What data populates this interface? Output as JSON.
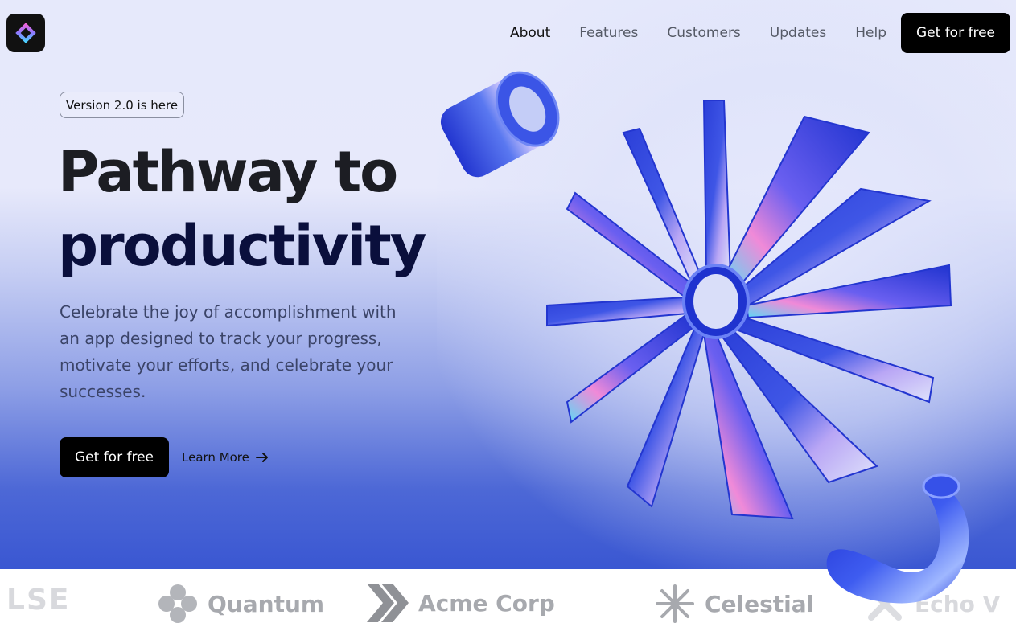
{
  "nav": {
    "items": [
      {
        "label": "About",
        "active": true
      },
      {
        "label": "Features",
        "active": false
      },
      {
        "label": "Customers",
        "active": false
      },
      {
        "label": "Updates",
        "active": false
      },
      {
        "label": "Help",
        "active": false
      }
    ],
    "cta_label": "Get for free"
  },
  "hero": {
    "badge": "Version 2.0 is here",
    "title_line1": "Pathway to",
    "title_line2": "productivity",
    "subtitle": "Celebrate the joy of accomplishment with an app designed to track your progress, motivate your efforts, and celebrate your successes.",
    "primary_cta": "Get for free",
    "secondary_cta": "Learn More"
  },
  "logos": [
    {
      "name": "LSE",
      "icon": "none"
    },
    {
      "name": "Quantum",
      "icon": "clover-icon"
    },
    {
      "name": "Acme Corp",
      "icon": "chevrons-icon"
    },
    {
      "name": "Celestial",
      "icon": "asterisk-icon"
    },
    {
      "name": "Echo V",
      "icon": "x-icon"
    }
  ],
  "colors": {
    "accent_blue": "#3b57d6",
    "cta_bg": "#000000",
    "text_dark": "#1c1d23",
    "title_navy": "#0a0f3c",
    "body_text": "#3b4468",
    "logo_gray": "#a7a9ae"
  }
}
